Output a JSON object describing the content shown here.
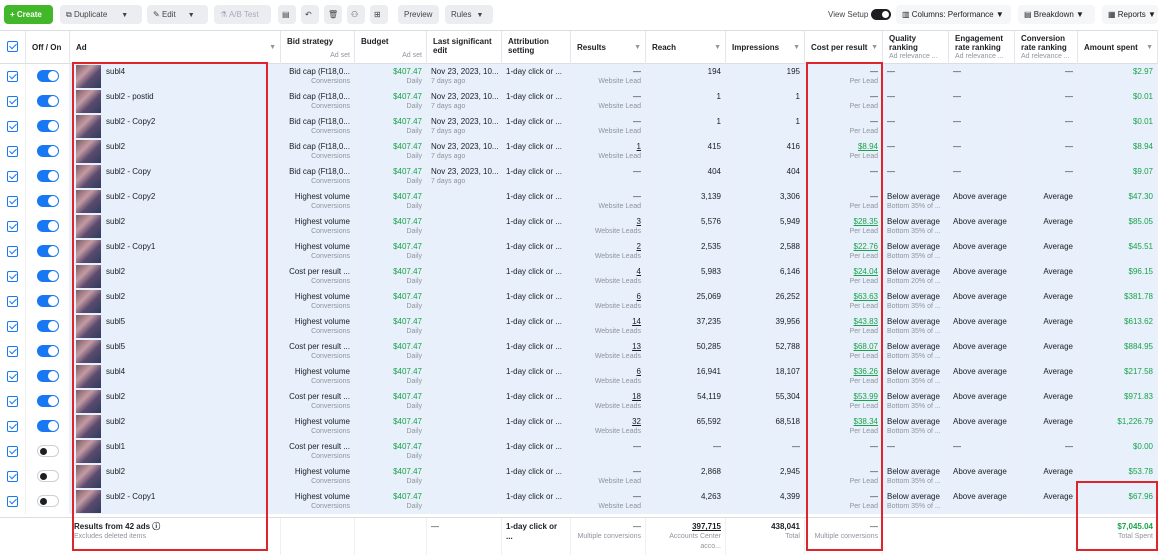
{
  "toolbar": {
    "create": "Create",
    "duplicate": "Duplicate",
    "edit": "Edit",
    "ab_test": "A/B Test",
    "preview": "Preview",
    "rules": "Rules",
    "view_setup": "View Setup",
    "columns": "Columns: Performance",
    "breakdown": "Breakdown",
    "reports": "Reports"
  },
  "columns": {
    "offon": "Off / On",
    "ad": "Ad",
    "bid": "Bid strategy",
    "bid_sub": "Ad set",
    "budget": "Budget",
    "budget_sub": "Ad set",
    "last_edit": "Last significant edit",
    "attribution": "Attribution setting",
    "results": "Results",
    "reach": "Reach",
    "impressions": "Impressions",
    "cpr": "Cost per result",
    "quality": "Quality ranking",
    "quality_sub": "Ad relevance ...",
    "engagement": "Engagement rate ranking",
    "engagement_sub": "Ad relevance ...",
    "conversion": "Conversion rate ranking",
    "conversion_sub": "Ad relevance ...",
    "amount": "Amount spent"
  },
  "rows": [
    {
      "on": true,
      "ad": "subl4",
      "bid": "Bid cap (Ft18,0...",
      "bid_sub": "Conversions",
      "budget": "$407.47",
      "budget_sub": "Daily",
      "edit": "Nov 23, 2023, 10...",
      "edit_sub": "7 days ago",
      "attr": "1-day click or ...",
      "res": "—",
      "res_sub": "Website Lead",
      "reach": "194",
      "impr": "195",
      "cpr": "—",
      "cpr_sub": "Per Lead",
      "q": "—",
      "q_sub": "",
      "e": "—",
      "c": "—",
      "amount": "$2.97"
    },
    {
      "on": true,
      "ad": "subl2 - postid",
      "bid": "Bid cap (Ft18,0...",
      "bid_sub": "Conversions",
      "budget": "$407.47",
      "budget_sub": "Daily",
      "edit": "Nov 23, 2023, 10...",
      "edit_sub": "7 days ago",
      "attr": "1-day click or ...",
      "res": "—",
      "res_sub": "Website Lead",
      "reach": "1",
      "impr": "1",
      "cpr": "—",
      "cpr_sub": "Per Lead",
      "q": "—",
      "q_sub": "",
      "e": "—",
      "c": "—",
      "amount": "$0.01"
    },
    {
      "on": true,
      "ad": "subl2 - Copy2",
      "bid": "Bid cap (Ft18,0...",
      "bid_sub": "Conversions",
      "budget": "$407.47",
      "budget_sub": "Daily",
      "edit": "Nov 23, 2023, 10...",
      "edit_sub": "7 days ago",
      "attr": "1-day click or ...",
      "res": "—",
      "res_sub": "Website Lead",
      "reach": "1",
      "impr": "1",
      "cpr": "—",
      "cpr_sub": "Per Lead",
      "q": "—",
      "q_sub": "",
      "e": "—",
      "c": "—",
      "amount": "$0.01"
    },
    {
      "on": true,
      "ad": "subl2",
      "bid": "Bid cap (Ft18,0...",
      "bid_sub": "Conversions",
      "budget": "$407.47",
      "budget_sub": "Daily",
      "edit": "Nov 23, 2023, 10...",
      "edit_sub": "7 days ago",
      "attr": "1-day click or ...",
      "res": "1",
      "res_sub": "Website Lead",
      "reach": "415",
      "impr": "416",
      "cpr": "$8.94",
      "cpr_sub": "Per Lead",
      "q": "—",
      "q_sub": "",
      "e": "—",
      "c": "—",
      "amount": "$8.94"
    },
    {
      "on": true,
      "ad": "subl2 - Copy",
      "bid": "Bid cap (Ft18,0...",
      "bid_sub": "Conversions",
      "budget": "$407.47",
      "budget_sub": "Daily",
      "edit": "Nov 23, 2023, 10...",
      "edit_sub": "7 days ago",
      "attr": "1-day click or ...",
      "res": "—",
      "res_sub": "",
      "reach": "404",
      "impr": "404",
      "cpr": "—",
      "cpr_sub": "",
      "q": "—",
      "q_sub": "",
      "e": "—",
      "c": "—",
      "amount": "$9.07"
    },
    {
      "on": true,
      "ad": "subl2 - Copy2",
      "bid": "Highest volume",
      "bid_sub": "Conversions",
      "budget": "$407.47",
      "budget_sub": "Daily",
      "edit": "",
      "edit_sub": "",
      "attr": "1-day click or ...",
      "res": "—",
      "res_sub": "Website Lead",
      "reach": "3,139",
      "impr": "3,306",
      "cpr": "—",
      "cpr_sub": "Per Lead",
      "q": "Below average",
      "q_sub": "Bottom 35% of ...",
      "e": "Above average",
      "c": "Average",
      "amount": "$47.30"
    },
    {
      "on": true,
      "ad": "subl2",
      "bid": "Highest volume",
      "bid_sub": "Conversions",
      "budget": "$407.47",
      "budget_sub": "Daily",
      "edit": "",
      "edit_sub": "",
      "attr": "1-day click or ...",
      "res": "3",
      "res_sub": "Website Leads",
      "reach": "5,576",
      "impr": "5,949",
      "cpr": "$28.35",
      "cpr_sub": "Per Lead",
      "q": "Below average",
      "q_sub": "Bottom 35% of ...",
      "e": "Above average",
      "c": "Average",
      "amount": "$85.05"
    },
    {
      "on": true,
      "ad": "subl2 - Copy1",
      "bid": "Highest volume",
      "bid_sub": "Conversions",
      "budget": "$407.47",
      "budget_sub": "Daily",
      "edit": "",
      "edit_sub": "",
      "attr": "1-day click or ...",
      "res": "2",
      "res_sub": "Website Leads",
      "reach": "2,535",
      "impr": "2,588",
      "cpr": "$22.76",
      "cpr_sub": "Per Lead",
      "q": "Below average",
      "q_sub": "Bottom 35% of ...",
      "e": "Above average",
      "c": "Average",
      "amount": "$45.51"
    },
    {
      "on": true,
      "ad": "subl2",
      "bid": "Cost per result ...",
      "bid_sub": "Conversions",
      "budget": "$407.47",
      "budget_sub": "Daily",
      "edit": "",
      "edit_sub": "",
      "attr": "1-day click or ...",
      "res": "4",
      "res_sub": "Website Leads",
      "reach": "5,983",
      "impr": "6,146",
      "cpr": "$24.04",
      "cpr_sub": "Per Lead",
      "q": "Below average",
      "q_sub": "Bottom 20% of ...",
      "e": "Above average",
      "c": "Average",
      "amount": "$96.15"
    },
    {
      "on": true,
      "ad": "subl2",
      "bid": "Highest volume",
      "bid_sub": "Conversions",
      "budget": "$407.47",
      "budget_sub": "Daily",
      "edit": "",
      "edit_sub": "",
      "attr": "1-day click or ...",
      "res": "6",
      "res_sub": "Website Leads",
      "reach": "25,069",
      "impr": "26,252",
      "cpr": "$63.63",
      "cpr_sub": "Per Lead",
      "q": "Below average",
      "q_sub": "Bottom 35% of ...",
      "e": "Above average",
      "c": "Average",
      "amount": "$381.78"
    },
    {
      "on": true,
      "ad": "subl5",
      "bid": "Highest volume",
      "bid_sub": "Conversions",
      "budget": "$407.47",
      "budget_sub": "Daily",
      "edit": "",
      "edit_sub": "",
      "attr": "1-day click or ...",
      "res": "14",
      "res_sub": "Website Leads",
      "reach": "37,235",
      "impr": "39,956",
      "cpr": "$43.83",
      "cpr_sub": "Per Lead",
      "q": "Below average",
      "q_sub": "Bottom 35% of ...",
      "e": "Above average",
      "c": "Average",
      "amount": "$613.62"
    },
    {
      "on": true,
      "ad": "subl5",
      "bid": "Cost per result ...",
      "bid_sub": "Conversions",
      "budget": "$407.47",
      "budget_sub": "Daily",
      "edit": "",
      "edit_sub": "",
      "attr": "1-day click or ...",
      "res": "13",
      "res_sub": "Website Leads",
      "reach": "50,285",
      "impr": "52,788",
      "cpr": "$68.07",
      "cpr_sub": "Per Lead",
      "q": "Below average",
      "q_sub": "Bottom 35% of ...",
      "e": "Above average",
      "c": "Average",
      "amount": "$884.95"
    },
    {
      "on": true,
      "ad": "subl4",
      "bid": "Highest volume",
      "bid_sub": "Conversions",
      "budget": "$407.47",
      "budget_sub": "Daily",
      "edit": "",
      "edit_sub": "",
      "attr": "1-day click or ...",
      "res": "6",
      "res_sub": "Website Leads",
      "reach": "16,941",
      "impr": "18,107",
      "cpr": "$36.26",
      "cpr_sub": "Per Lead",
      "q": "Below average",
      "q_sub": "Bottom 35% of ...",
      "e": "Above average",
      "c": "Average",
      "amount": "$217.58"
    },
    {
      "on": true,
      "ad": "subl2",
      "bid": "Cost per result ...",
      "bid_sub": "Conversions",
      "budget": "$407.47",
      "budget_sub": "Daily",
      "edit": "",
      "edit_sub": "",
      "attr": "1-day click or ...",
      "res": "18",
      "res_sub": "Website Leads",
      "reach": "54,119",
      "impr": "55,304",
      "cpr": "$53.99",
      "cpr_sub": "Per Lead",
      "q": "Below average",
      "q_sub": "Bottom 35% of ...",
      "e": "Above average",
      "c": "Average",
      "amount": "$971.83"
    },
    {
      "on": true,
      "ad": "subl2",
      "bid": "Highest volume",
      "bid_sub": "Conversions",
      "budget": "$407.47",
      "budget_sub": "Daily",
      "edit": "",
      "edit_sub": "",
      "attr": "1-day click or ...",
      "res": "32",
      "res_sub": "Website Leads",
      "reach": "65,592",
      "impr": "68,518",
      "cpr": "$38.34",
      "cpr_sub": "Per Lead",
      "q": "Below average",
      "q_sub": "Bottom 35% of ...",
      "e": "Above average",
      "c": "Average",
      "amount": "$1,226.79"
    },
    {
      "on": false,
      "ad": "subl1",
      "bid": "Cost per result ...",
      "bid_sub": "Conversions",
      "budget": "$407.47",
      "budget_sub": "Daily",
      "edit": "",
      "edit_sub": "",
      "attr": "1-day click or ...",
      "res": "—",
      "res_sub": "",
      "reach": "—",
      "impr": "—",
      "cpr": "—",
      "cpr_sub": "",
      "q": "—",
      "q_sub": "",
      "e": "—",
      "c": "—",
      "amount": "$0.00"
    },
    {
      "on": false,
      "ad": "subl2",
      "bid": "Highest volume",
      "bid_sub": "Conversions",
      "budget": "$407.47",
      "budget_sub": "Daily",
      "edit": "",
      "edit_sub": "",
      "attr": "1-day click or ...",
      "res": "—",
      "res_sub": "Website Lead",
      "reach": "2,868",
      "impr": "2,945",
      "cpr": "—",
      "cpr_sub": "Per Lead",
      "q": "Below average",
      "q_sub": "Bottom 35% of ...",
      "e": "Above average",
      "c": "Average",
      "amount": "$53.78"
    },
    {
      "on": false,
      "ad": "subl2 - Copy1",
      "bid": "Highest volume",
      "bid_sub": "Conversions",
      "budget": "$407.47",
      "budget_sub": "Daily",
      "edit": "",
      "edit_sub": "",
      "attr": "1-day click or ...",
      "res": "—",
      "res_sub": "Website Lead",
      "reach": "4,263",
      "impr": "4,399",
      "cpr": "—",
      "cpr_sub": "Per Lead",
      "q": "Below average",
      "q_sub": "Bottom 35% of ...",
      "e": "Above average",
      "c": "Average",
      "amount": "$67.96"
    }
  ],
  "footer": {
    "title": "Results from 42 ads",
    "sub": "Excludes deleted items",
    "edit": "—",
    "attr": "1-day click or ...",
    "res": "—",
    "res_sub": "Multiple conversions",
    "reach": "397,715",
    "reach_sub": "Accounts Center acco...",
    "impr": "438,041",
    "impr_sub": "Total",
    "cpr": "—",
    "cpr_sub": "Multiple conversions",
    "amount": "$7,045.04",
    "amount_sub": "Total Spent"
  },
  "colors": {
    "accent": "#1877f2",
    "create": "#42b72a",
    "money": "#1aa34a",
    "highlight": "#e0242b"
  }
}
